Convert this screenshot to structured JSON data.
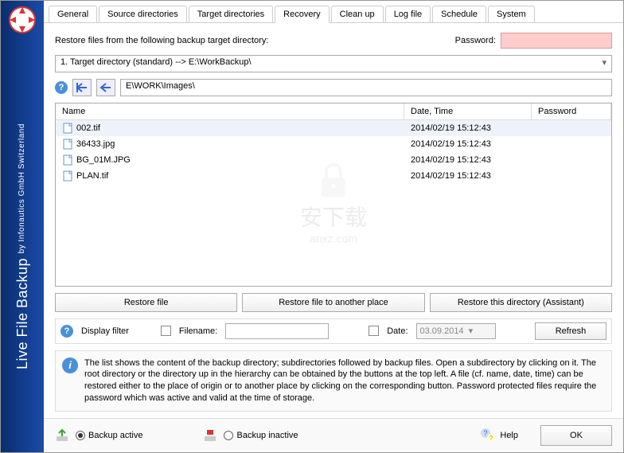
{
  "sidebar": {
    "title_main": "Live File Backup",
    "title_sub": "by Infonautics GmbH Switzerland"
  },
  "tabs": [
    "General",
    "Source directories",
    "Target directories",
    "Recovery",
    "Clean up",
    "Log file",
    "Schedule",
    "System"
  ],
  "active_tab": 3,
  "restore_label": "Restore files from the following backup target directory:",
  "password_label": "Password:",
  "target_dropdown": "1. Target directory (standard) --> E:\\WorkBackup\\",
  "path_value": "E\\WORK\\Images\\",
  "columns": {
    "name": "Name",
    "date": "Date, Time",
    "password": "Password"
  },
  "files": [
    {
      "name": "002.tif",
      "date": "2014/02/19  15:12:43"
    },
    {
      "name": "36433.jpg",
      "date": "2014/02/19  15:12:43"
    },
    {
      "name": "BG_01M.JPG",
      "date": "2014/02/19  15:12:43"
    },
    {
      "name": "PLAN.tif",
      "date": "2014/02/19  15:12:43"
    }
  ],
  "buttons": {
    "restore_file": "Restore file",
    "restore_other": "Restore file to another place",
    "restore_dir": "Restore this directory (Assistant)"
  },
  "filter": {
    "label": "Display filter",
    "filename_label": "Filename:",
    "date_label": "Date:",
    "date_value": "03.09.2014",
    "refresh": "Refresh"
  },
  "info_text": "The list shows the content of the backup directory; subdirectories followed by backup files. Open a subdirectory by clicking on it. The root directory or the directory up in the hierarchy can be obtained by the buttons at the top left. A file (cf. name, date, time)  can be restored either to the place of origin or to another place by clicking on the corresponding button. Password protected files require the password which was active and valid at the time of storage.",
  "bottom": {
    "backup_active": "Backup active",
    "backup_inactive": "Backup inactive",
    "help": "Help",
    "ok": "OK"
  },
  "watermark": {
    "main": "安下载",
    "sub": "anxz.com"
  }
}
